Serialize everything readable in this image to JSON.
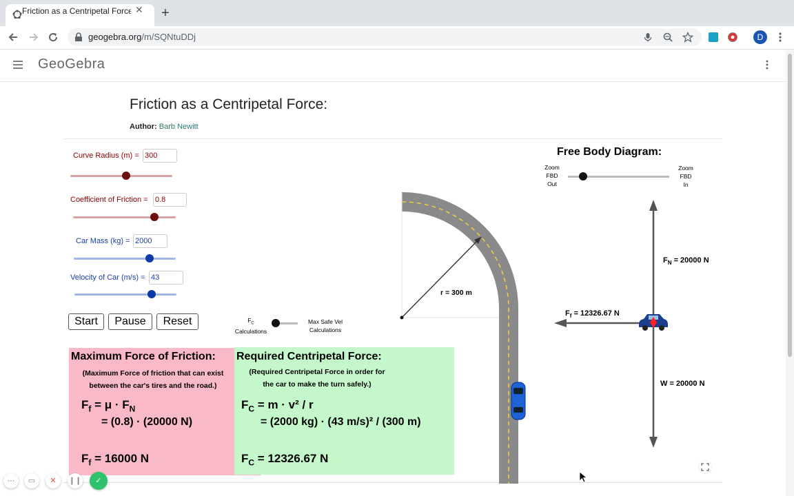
{
  "browser": {
    "tab_title": "Friction as a Centripetal Force",
    "close_glyph": "✕",
    "new_tab_glyph": "+",
    "url_domain": "geogebra.org",
    "url_path": "/m/SQNtuDDj",
    "profile_initial": "D"
  },
  "site": {
    "logo": "GeoGebra",
    "title": "Friction as a Centripetal Force:",
    "author_label": "Author:",
    "author_name": "Barb Newitt"
  },
  "controls": {
    "radius": {
      "label": "Curve Radius (m) =",
      "value": "300",
      "slider_fraction": 0.55
    },
    "friction": {
      "label": "Coefficient of Friction =",
      "value": "0.8",
      "slider_fraction": 0.79
    },
    "mass": {
      "label": "Car Mass (kg) =",
      "value": "2000",
      "slider_fraction": 0.74
    },
    "velocity": {
      "label": "Velocity of Car (m/s) =",
      "value": "43",
      "slider_fraction": 0.76
    },
    "buttons": {
      "start": "Start",
      "pause": "Pause",
      "reset": "Reset"
    },
    "mode_toggle": {
      "left_sub": "C",
      "left_base": "F",
      "left_word": "Calculations",
      "right_line1": "Max Safe Vel",
      "right_line2": "Calculations"
    }
  },
  "friction_panel": {
    "heading": "Maximum Force of Friction:",
    "desc_line1": "(Maximum Force of friction that can exist",
    "desc_line2": "between the car's tires and the road.)",
    "eq1": "= μ · F",
    "eq1_sub": "N",
    "eq2": "= (0.8) · (20000 N)",
    "result": "=  16000  N",
    "sym": "F",
    "sym_sub": "f"
  },
  "centripetal_panel": {
    "heading": "Required Centripetal Force:",
    "desc_line1": "(Required Centripetal Force in order for",
    "desc_line2": "the car to make the turn safely.)",
    "eq1": "=  m · v² / r",
    "eq2": "= (2000  kg) · (43 m/s)² / (300 m)",
    "result": "=  12326.67 N",
    "sym": "F",
    "sym_sub": "C"
  },
  "road": {
    "radius_label": "r  =  300 m"
  },
  "fbd": {
    "title": "Free Body Diagram:",
    "zoom_out": [
      "Zoom",
      "FBD",
      "Out"
    ],
    "zoom_in": [
      "Zoom",
      "FBD",
      "In"
    ],
    "zoom_fraction": 0.15,
    "normal": {
      "base": "F",
      "sub": "N",
      "value": "=  20000 N"
    },
    "friction": {
      "base": "F",
      "sub": "f",
      "value": "=  12326.67 N"
    },
    "weight": "W  =  20000 N"
  },
  "colors": {
    "friction_bg": "#f9b9c6",
    "centripetal_bg": "#c4f8cb",
    "road": "#8a8a8a",
    "lane": "#f4d03f",
    "slider_red": "#d9a3a3",
    "slider_blue": "#9fb6e6",
    "knob_red": "#6d0f0f",
    "knob_blue": "#0b3aa5",
    "record_green": "#2dc26b"
  }
}
